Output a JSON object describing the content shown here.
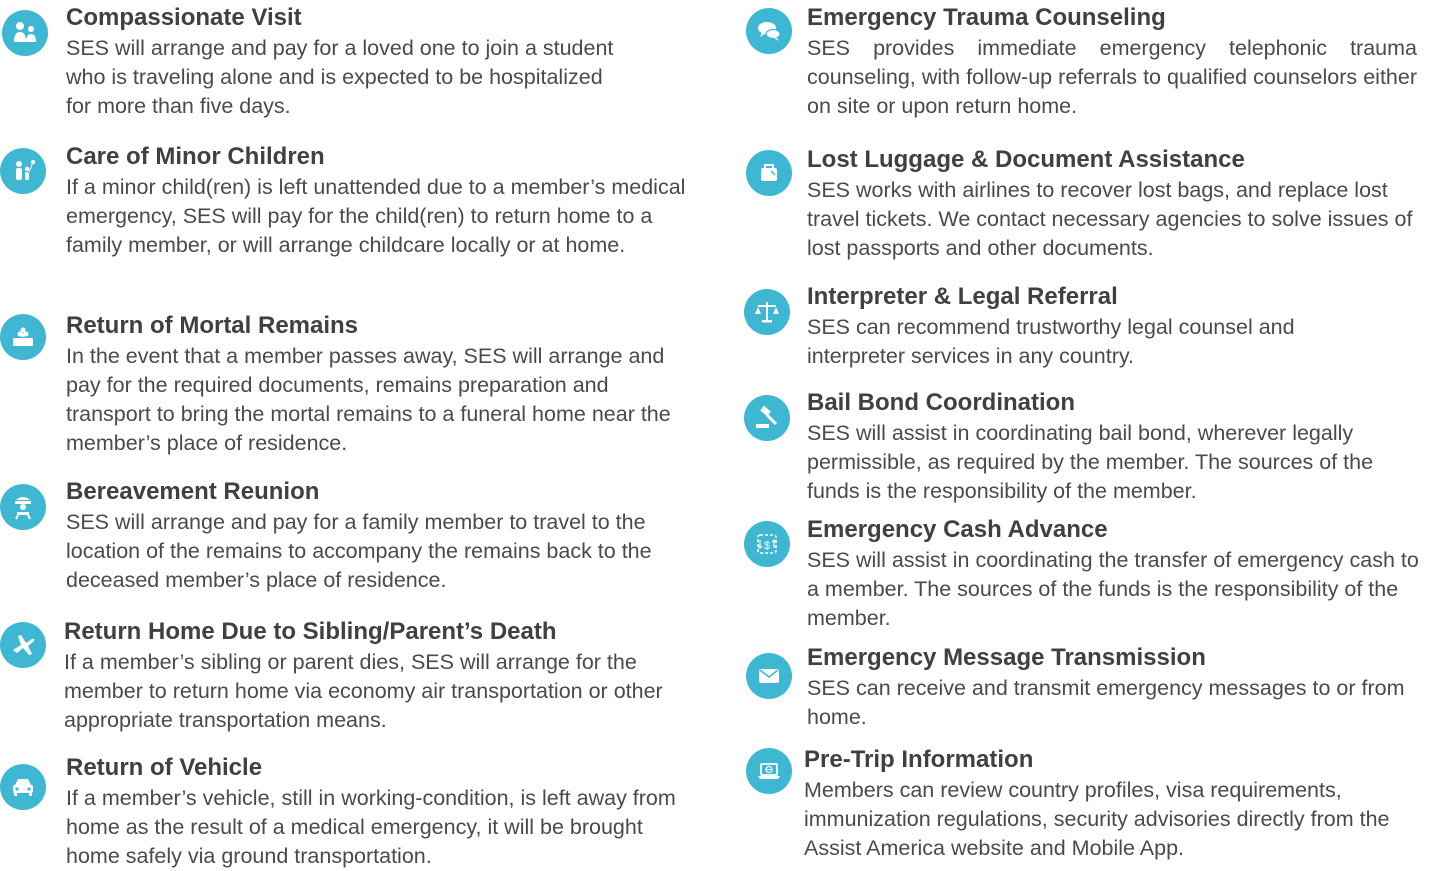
{
  "left": [
    {
      "icon": "family-visit-icon",
      "title": "Compassionate Visit",
      "description": "SES will arrange and pay for a loved one to join a student who is traveling alone and is expected to be hospitalized for more than five days."
    },
    {
      "icon": "children-icon",
      "title": "Care of Minor Children",
      "description": "If a minor child(ren) is left unattended due to a member’s medical emergency, SES will pay for the child(ren) to return home to a family member, or will arrange childcare locally or at home."
    },
    {
      "icon": "memorial-icon",
      "title": "Return of Mortal Remains",
      "description": "In the event that a member passes away, SES will arrange and pay for the required documents, remains preparation and transport to bring the mortal remains to a funeral home near the member’s place of residence."
    },
    {
      "icon": "reunion-icon",
      "title": "Bereavement Reunion",
      "description": "SES will arrange and pay for a family member to travel to the location of the remains to accompany the remains back to the deceased member’s place of residence."
    },
    {
      "icon": "airplane-icon",
      "title": "Return Home Due to Sibling/Parent’s Death",
      "description": "If a member’s sibling or parent dies, SES will arrange for the member to return home via economy air transportation or other appropriate transportation means."
    },
    {
      "icon": "car-icon",
      "title": "Return of Vehicle",
      "description": "If a member’s vehicle, still in working-condition, is left away from home as the result of a medical emergency, it will be brought home safely via ground transportation."
    }
  ],
  "right": [
    {
      "icon": "chat-bubbles-icon",
      "title": "Emergency Trauma Counseling",
      "description": "SES provides immediate emergency telephonic trauma counseling, with follow-up referrals to qualified counselors either on site or upon return home."
    },
    {
      "icon": "luggage-icon",
      "title": "Lost Luggage & Document Assistance",
      "description": "SES works with airlines to recover lost bags, and replace lost travel tickets. We contact necessary agencies to solve issues of lost passports and other documents."
    },
    {
      "icon": "scales-icon",
      "title": "Interpreter & Legal Referral",
      "description": "SES can recommend trustworthy legal counsel and interpreter services in any country."
    },
    {
      "icon": "gavel-icon",
      "title": "Bail Bond Coordination",
      "description": "SES will assist in coordinating bail bond, wherever legally permissible, as required by the member. The sources of the funds is the responsibility of the member."
    },
    {
      "icon": "cash-transfer-icon",
      "title": "Emergency Cash Advance",
      "description": "SES will assist in coordinating the transfer of emergency cash to a member. The sources of the funds is the responsibility of the member."
    },
    {
      "icon": "envelope-icon",
      "title": "Emergency Message Transmission",
      "description": "SES can receive and transmit emergency messages to or from home."
    },
    {
      "icon": "laptop-globe-icon",
      "title": "Pre-Trip Information",
      "description": "Members can review country profiles, visa requirements, immunization regulations, security advisories directly from the Assist America website and Mobile App."
    }
  ],
  "colors": {
    "accent": "#3fb7d3",
    "title_text": "#404040",
    "body_text": "#4a4a4a"
  }
}
